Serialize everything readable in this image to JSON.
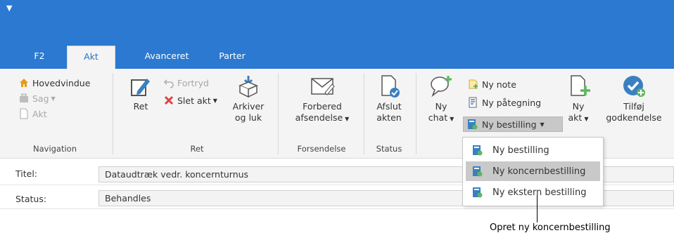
{
  "qat_glyph": "▼",
  "tabs": [
    "F2",
    "Akt",
    "Avanceret",
    "Parter"
  ],
  "navigation": {
    "items": [
      "Hovedvindue",
      "Sag",
      "Akt"
    ],
    "label": "Navigation"
  },
  "ret_group": {
    "ret": "Ret",
    "fortryd": "Fortryd",
    "slet_akt": "Slet akt",
    "arkiver_line1": "Arkiver",
    "arkiver_line2": "og luk",
    "label": "Ret"
  },
  "forsendelse_group": {
    "line1": "Forbered",
    "line2": "afsendelse",
    "label": "Forsendelse"
  },
  "status_group": {
    "line1": "Afslut",
    "line2": "akten",
    "label": "Status"
  },
  "last_group": {
    "ny_chat_line1": "Ny",
    "ny_chat_line2": "chat",
    "ny_note": "Ny note",
    "ny_paategning": "Ny påtegning",
    "ny_bestilling": "Ny bestilling",
    "ny_akt_line1": "Ny",
    "ny_akt_line2": "akt",
    "tilfoj_line1": "Tilføj",
    "tilfoj_line2": "godkendelse"
  },
  "fields": {
    "titel_label": "Titel:",
    "titel_value": "Dataudtræk vedr. koncernturnus",
    "status_label": "Status:",
    "status_value": "Behandles"
  },
  "dropdown_menu": {
    "items": [
      "Ny bestilling",
      "Ny koncernbestilling",
      "Ny ekstern bestilling"
    ],
    "highlighted_index": 1
  },
  "callout": "Opret ny koncernbestilling",
  "colors": {
    "titlebar": "#2b79d0",
    "accent_green": "#5cb85c",
    "icon_blue": "#3a7fc1",
    "delete_red": "#e04040"
  }
}
